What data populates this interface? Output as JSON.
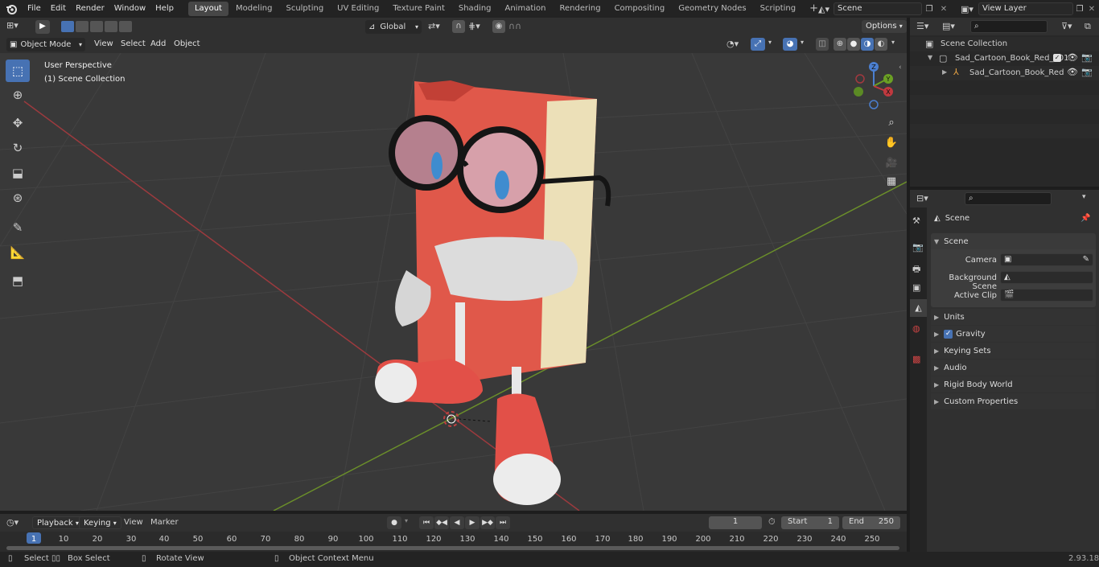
{
  "top_menu": [
    "File",
    "Edit",
    "Render",
    "Window",
    "Help"
  ],
  "workspaces": [
    "Layout",
    "Modeling",
    "Sculpting",
    "UV Editing",
    "Texture Paint",
    "Shading",
    "Animation",
    "Rendering",
    "Compositing",
    "Geometry Nodes",
    "Scripting"
  ],
  "active_workspace": "Layout",
  "scene_name": "Scene",
  "view_layer": "View Layer",
  "viewport": {
    "mode": "Object Mode",
    "menus": [
      "View",
      "Select",
      "Add",
      "Object"
    ],
    "transform_orientation": "Global",
    "options_label": "Options",
    "overlay_text_1": "User Perspective",
    "overlay_text_2": "(1) Scene Collection"
  },
  "gizmo": {
    "z": "Z",
    "y": "Y",
    "x": "X"
  },
  "outliner": {
    "root": "Scene Collection",
    "items": [
      {
        "label": "Sad_Cartoon_Book_Red_001"
      },
      {
        "label": "Sad_Cartoon_Book_Red"
      }
    ]
  },
  "properties": {
    "context_title": "Scene",
    "panel_title": "Scene",
    "fields": [
      {
        "label": "Camera"
      },
      {
        "label": "Background Scene"
      },
      {
        "label": "Active Clip"
      }
    ],
    "collapsed_panels": [
      "Units",
      "Gravity",
      "Keying Sets",
      "Audio",
      "Rigid Body World",
      "Custom Properties"
    ],
    "gravity_checked": true
  },
  "timeline": {
    "menus": [
      "Playback",
      "Keying",
      "View",
      "Marker"
    ],
    "current_frame": "1",
    "start_label": "Start",
    "start_value": "1",
    "end_label": "End",
    "end_value": "250",
    "ruler": [
      "1",
      "10",
      "20",
      "30",
      "40",
      "50",
      "60",
      "70",
      "80",
      "90",
      "100",
      "110",
      "120",
      "130",
      "140",
      "150",
      "160",
      "170",
      "180",
      "190",
      "200",
      "210",
      "220",
      "230",
      "240",
      "250"
    ]
  },
  "statusbar": {
    "select": "Select",
    "box_select": "Box Select",
    "rotate_view": "Rotate View",
    "context_menu": "Object Context Menu",
    "version": "2.93.18"
  },
  "colors": {
    "accent": "#4772b3",
    "x_axis": "#b3323b",
    "y_axis": "#6ba024",
    "book_red": "#e24f43"
  }
}
